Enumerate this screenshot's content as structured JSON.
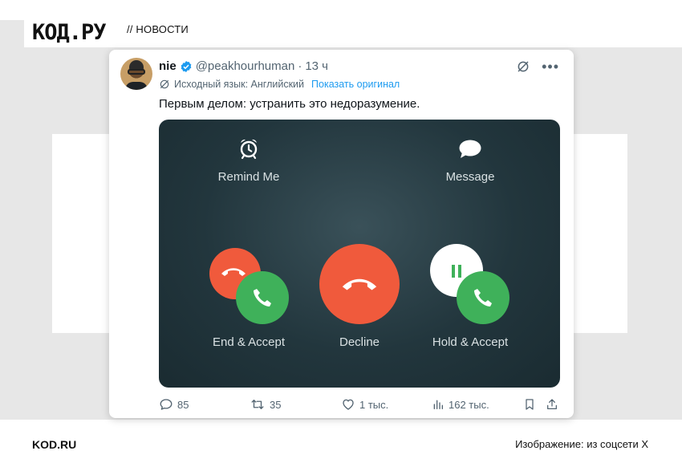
{
  "site": {
    "logo": "КОД.РУ",
    "section": "// НОВОСТИ",
    "footer_left": "KOD.RU",
    "footer_right": "Изображение: из соцсети X"
  },
  "tweet": {
    "display_name": "nie",
    "handle": "@peakhourhuman",
    "separator": "·",
    "time": "13 ч",
    "translation_note": "Исходный язык: Английский",
    "show_original": "Показать оригинал",
    "text": "Первым делом: устранить это недоразумение.",
    "icons": [
      "avatar",
      "verified-badge-icon",
      "grok-icon",
      "more-icon",
      "translate-icon"
    ]
  },
  "media": {
    "remind_me": "Remind Me",
    "message": "Message",
    "end_accept": "End & Accept",
    "decline": "Decline",
    "hold_accept": "Hold & Accept",
    "colors": {
      "decline": "#f05a3c",
      "accept": "#3fb15a",
      "hold": "#ffffff",
      "background": "#22363d"
    },
    "icons": [
      "alarm-clock-icon",
      "chat-bubble-icon",
      "hang-up-icon",
      "phone-icon",
      "pause-icon"
    ]
  },
  "actions": {
    "replies": "85",
    "reposts": "35",
    "likes": "1 тыс.",
    "views": "162 тыс.",
    "icons": [
      "reply-icon",
      "repost-icon",
      "like-icon",
      "views-icon",
      "bookmark-icon",
      "share-icon"
    ]
  }
}
